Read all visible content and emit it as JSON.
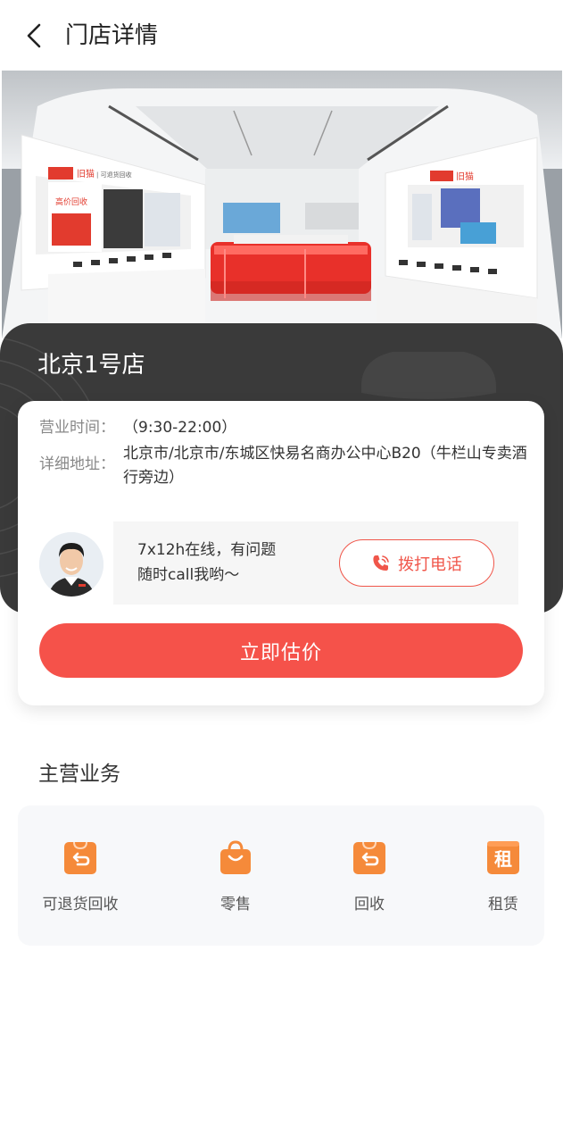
{
  "header": {
    "title": "门店详情",
    "back_icon": "chevron-left-icon"
  },
  "store": {
    "name": "北京1号店",
    "hours_label": "营业时间：",
    "hours_value": "（9:30-22:00）",
    "address_label": "详细地址：",
    "address_value": "北京市/北京市/东城区快易名商办公中心B20（牛栏山专卖酒行旁边）"
  },
  "hero": {
    "banner_left_brand": "旧猫",
    "banner_left_sub": "| 可退货回收",
    "banner_left_promo": "高价回收",
    "banner_right_brand": "旧猫"
  },
  "contact": {
    "text_line1": "7x12h在线，有问题",
    "text_line2": "随时call我哟～",
    "call_label": "拨打电话",
    "call_icon": "phone-icon"
  },
  "actions": {
    "estimate_label": "立即估价"
  },
  "business": {
    "title": "主营业务",
    "items": [
      {
        "label": "可退货回收",
        "icon": "return-bag-icon"
      },
      {
        "label": "零售",
        "icon": "shopping-bag-icon"
      },
      {
        "label": "回收",
        "icon": "recycle-bag-icon"
      },
      {
        "label": "租赁",
        "icon": "rent-icon",
        "glyph": "租"
      }
    ]
  },
  "colors": {
    "accent": "#f5524a",
    "icon_orange": "#f58a3a",
    "dark_band": "#3a3a3a"
  }
}
